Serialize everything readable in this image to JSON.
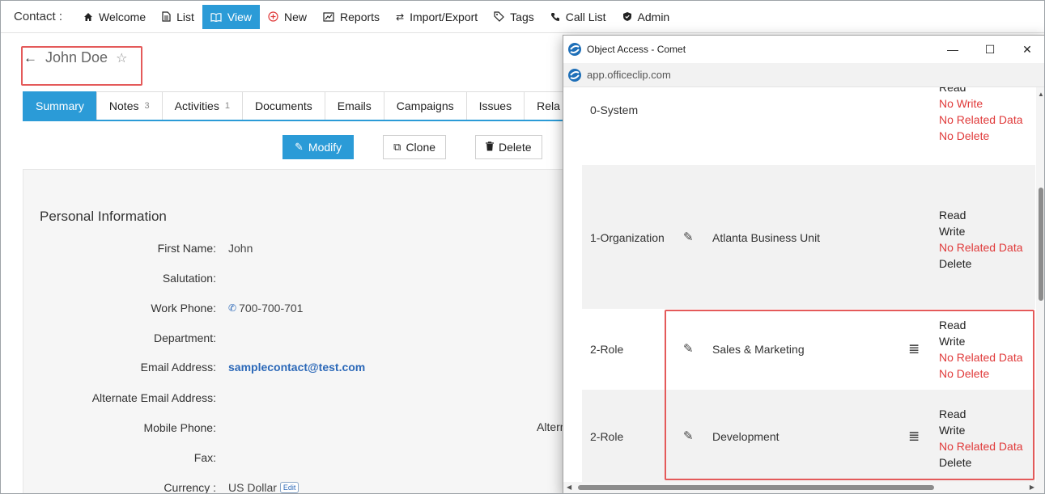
{
  "nav": {
    "brand": "Contact :",
    "items": [
      {
        "label": "Welcome",
        "icon": "home-icon"
      },
      {
        "label": "List",
        "icon": "document-icon"
      },
      {
        "label": "View",
        "icon": "book-icon",
        "active": true
      },
      {
        "label": "New",
        "icon": "plus-circle-icon"
      },
      {
        "label": "Reports",
        "icon": "chart-icon"
      },
      {
        "label": "Import/Export",
        "icon": "swap-icon"
      },
      {
        "label": "Tags",
        "icon": "tag-icon"
      },
      {
        "label": "Call List",
        "icon": "phone-icon"
      },
      {
        "label": "Admin",
        "icon": "shield-icon"
      }
    ]
  },
  "contact": {
    "name": "John Doe"
  },
  "tabs": [
    {
      "label": "Summary",
      "count": ""
    },
    {
      "label": "Notes",
      "count": "3"
    },
    {
      "label": "Activities",
      "count": "1"
    },
    {
      "label": "Documents",
      "count": ""
    },
    {
      "label": "Emails",
      "count": ""
    },
    {
      "label": "Campaigns",
      "count": ""
    },
    {
      "label": "Issues",
      "count": ""
    },
    {
      "label": "Rela",
      "count": ""
    }
  ],
  "actions": {
    "modify": "Modify",
    "clone": "Clone",
    "delete": "Delete"
  },
  "personal": {
    "title": "Personal Information",
    "fields": [
      {
        "label": "First Name:",
        "value": "John"
      },
      {
        "label": "Salutation:",
        "value": ""
      },
      {
        "label": "Work Phone:",
        "value": "700-700-701"
      },
      {
        "label": "Department:",
        "value": ""
      },
      {
        "label": "Email Address:",
        "value": "samplecontact@test.com"
      },
      {
        "label": "Alternate Email Address:",
        "value": ""
      },
      {
        "label": "Mobile Phone:",
        "value": ""
      },
      {
        "label": "Fax:",
        "value": ""
      },
      {
        "label": "Currency :",
        "value": "US Dollar"
      }
    ],
    "currency_edit": "Edit",
    "alt_label_partial": "Altern"
  },
  "popup": {
    "title": "Object Access - Comet",
    "url": "app.officeclip.com",
    "rows": [
      {
        "type": "0-System",
        "name": "",
        "perms": [
          {
            "t": "Read",
            "deny": false
          },
          {
            "t": "No Write",
            "deny": true
          },
          {
            "t": "No Related Data",
            "deny": true
          },
          {
            "t": "No Delete",
            "deny": true
          }
        ]
      },
      {
        "type": "1-Organization",
        "name": "Atlanta Business Unit",
        "perms": [
          {
            "t": "Read",
            "deny": false
          },
          {
            "t": "Write",
            "deny": false
          },
          {
            "t": "No Related Data",
            "deny": true
          },
          {
            "t": "Delete",
            "deny": false
          }
        ]
      },
      {
        "type": "2-Role",
        "name": "Sales & Marketing",
        "perms": [
          {
            "t": "Read",
            "deny": false
          },
          {
            "t": "Write",
            "deny": false
          },
          {
            "t": "No Related Data",
            "deny": true
          },
          {
            "t": "No Delete",
            "deny": true
          }
        ]
      },
      {
        "type": "2-Role",
        "name": "Development",
        "perms": [
          {
            "t": "Read",
            "deny": false
          },
          {
            "t": "Write",
            "deny": false
          },
          {
            "t": "No Related Data",
            "deny": true
          },
          {
            "t": "Delete",
            "deny": false
          }
        ]
      }
    ]
  },
  "colors": {
    "accent": "#2b9bd7",
    "deny": "#e03a3a",
    "highlight": "#e45a5a",
    "link": "#2b68b8"
  }
}
